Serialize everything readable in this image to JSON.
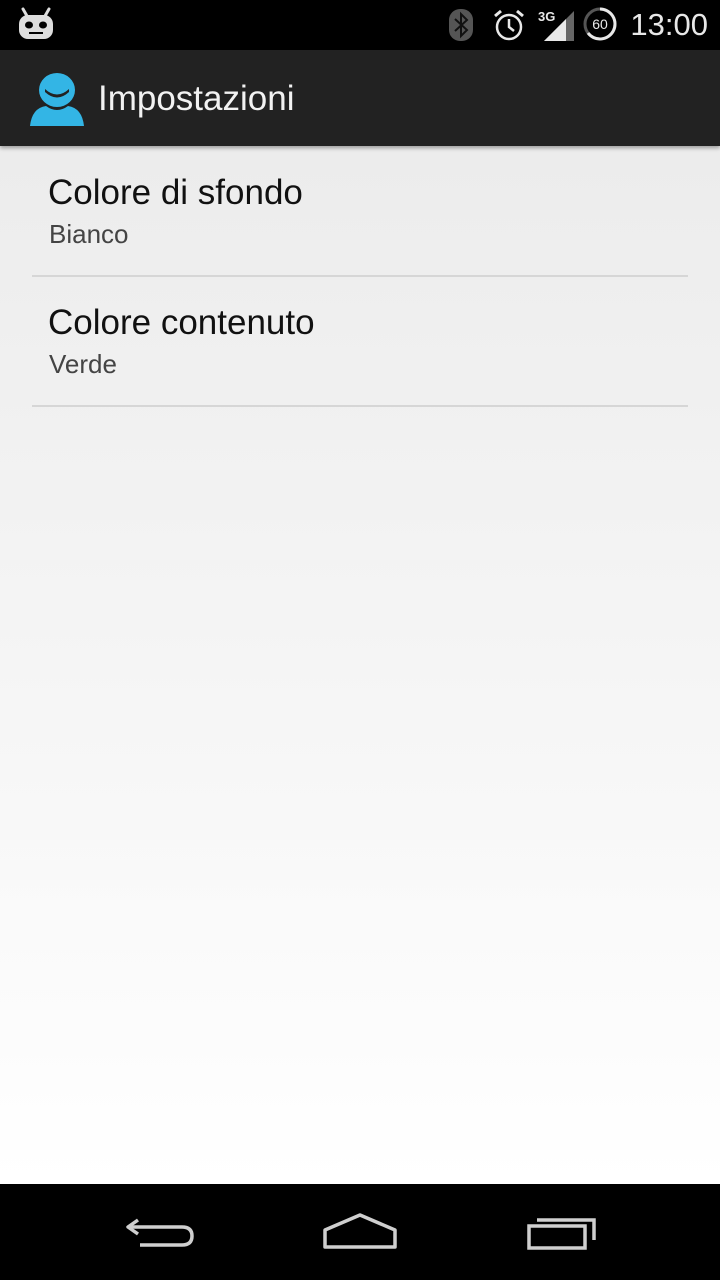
{
  "status_bar": {
    "time": "13:00",
    "network": "3G",
    "battery_text": "60",
    "icons": [
      "cyanogenmod-icon",
      "bluetooth-icon",
      "alarm-icon",
      "signal-icon",
      "battery-icon"
    ]
  },
  "action_bar": {
    "title": "Impostazioni",
    "icon": "app-icon",
    "accent": "#33b5e5",
    "background": "#222222"
  },
  "preferences": [
    {
      "title": "Colore di sfondo",
      "summary": "Bianco"
    },
    {
      "title": "Colore contenuto",
      "summary": "Verde"
    }
  ],
  "nav_bar": {
    "buttons": [
      "back-icon",
      "home-icon",
      "recents-icon"
    ]
  }
}
